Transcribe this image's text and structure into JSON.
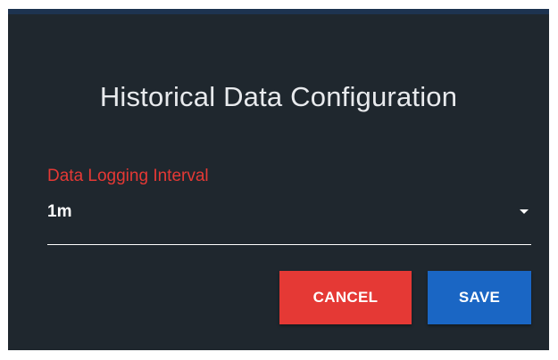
{
  "dialog": {
    "title": "Historical Data Configuration",
    "field": {
      "label": "Data Logging Interval",
      "value": "1m",
      "icon": "chevron-down-icon"
    },
    "buttons": {
      "cancel_label": "CANCEL",
      "save_label": "SAVE"
    }
  },
  "colors": {
    "background": "#1f272e",
    "title_text": "#e8eaed",
    "label_accent": "#e53935",
    "cancel_button": "#e53935",
    "save_button": "#1a66c4"
  }
}
